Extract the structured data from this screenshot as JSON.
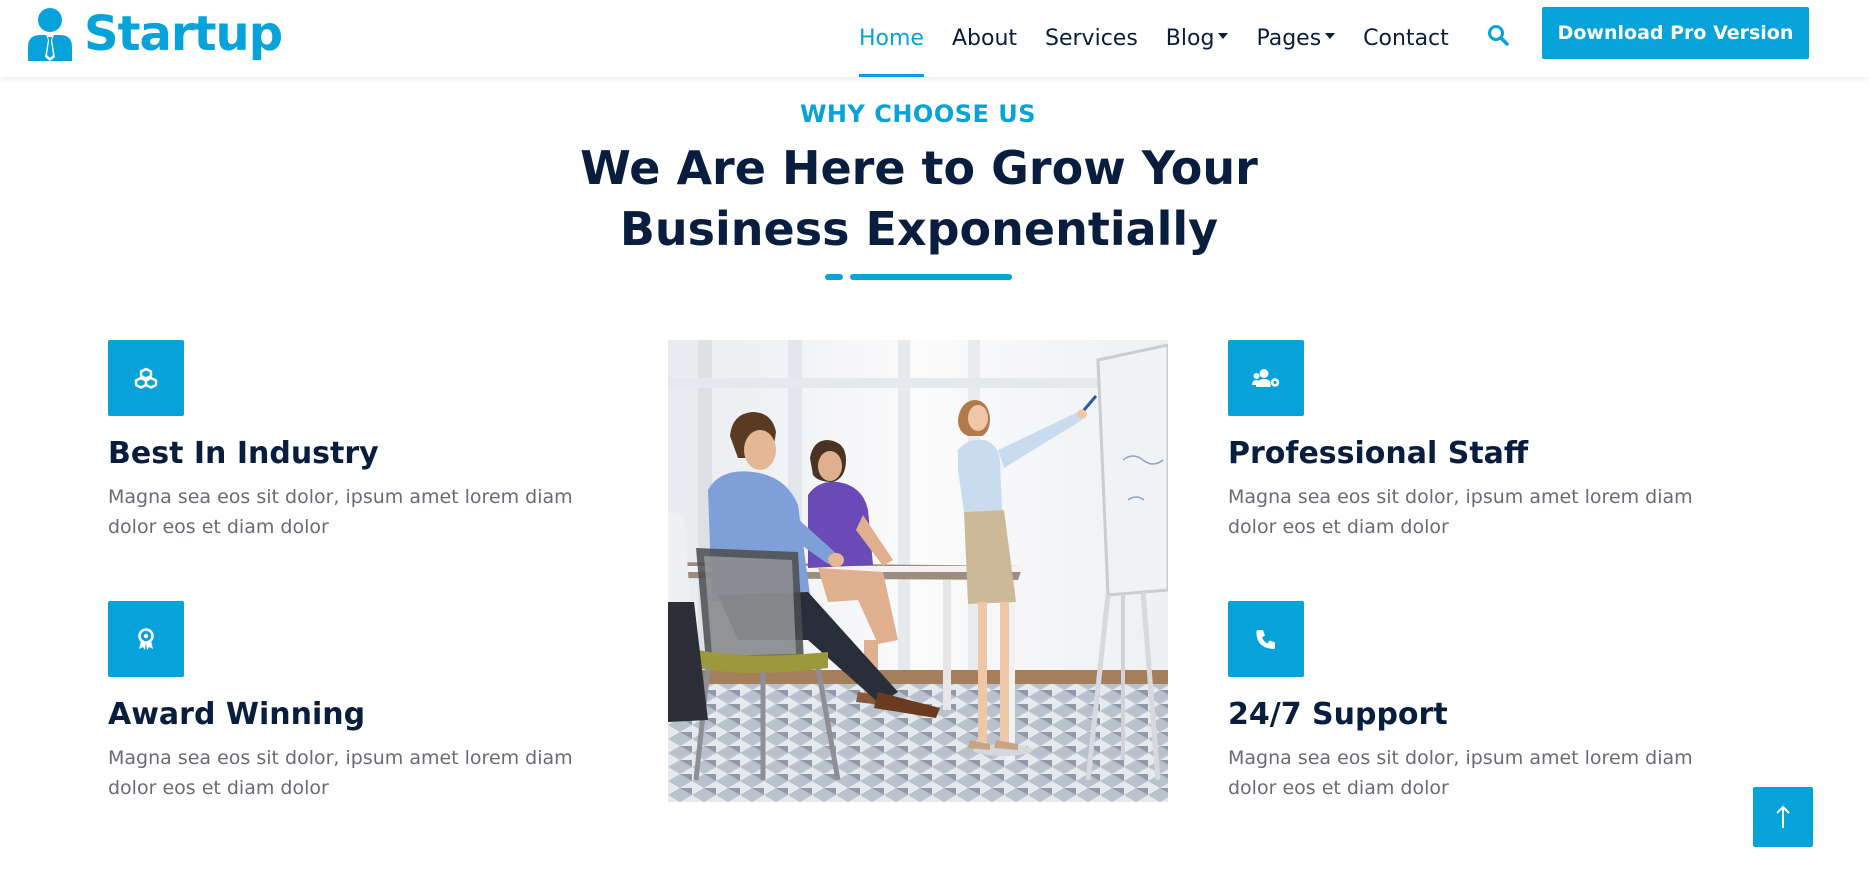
{
  "brand": {
    "name": "Startup",
    "icon": "user-tie-icon",
    "color": "#06a3da"
  },
  "nav": {
    "items": [
      {
        "label": "Home",
        "active": true
      },
      {
        "label": "About",
        "active": false
      },
      {
        "label": "Services",
        "active": false
      },
      {
        "label": "Blog",
        "active": false,
        "dropdown": true
      },
      {
        "label": "Pages",
        "active": false,
        "dropdown": true
      },
      {
        "label": "Contact",
        "active": false
      }
    ],
    "search_icon": "search-icon",
    "cta_label": "Download Pro Version"
  },
  "section": {
    "subtitle": "WHY CHOOSE US",
    "title_line1": "We Are Here to Grow Your",
    "title_line2": "Business Exponentially"
  },
  "features": [
    {
      "title": "Best In Industry",
      "text": "Magna sea eos sit dolor, ipsum amet lorem diam dolor eos et diam dolor",
      "icon": "cubes-icon"
    },
    {
      "title": "Award Winning",
      "text": "Magna sea eos sit dolor, ipsum amet lorem diam dolor eos et diam dolor",
      "icon": "award-icon"
    },
    {
      "title": "Professional Staff",
      "text": "Magna sea eos sit dolor, ipsum amet lorem diam dolor eos et diam dolor",
      "icon": "users-cog-icon"
    },
    {
      "title": "24/7 Support",
      "text": "Magna sea eos sit dolor, ipsum amet lorem diam dolor eos et diam dolor",
      "icon": "phone-icon"
    }
  ],
  "back_to_top_icon": "arrow-up-icon",
  "colors": {
    "primary": "#06a3da",
    "dark": "#091e3e",
    "body_text": "#6b6a75"
  }
}
